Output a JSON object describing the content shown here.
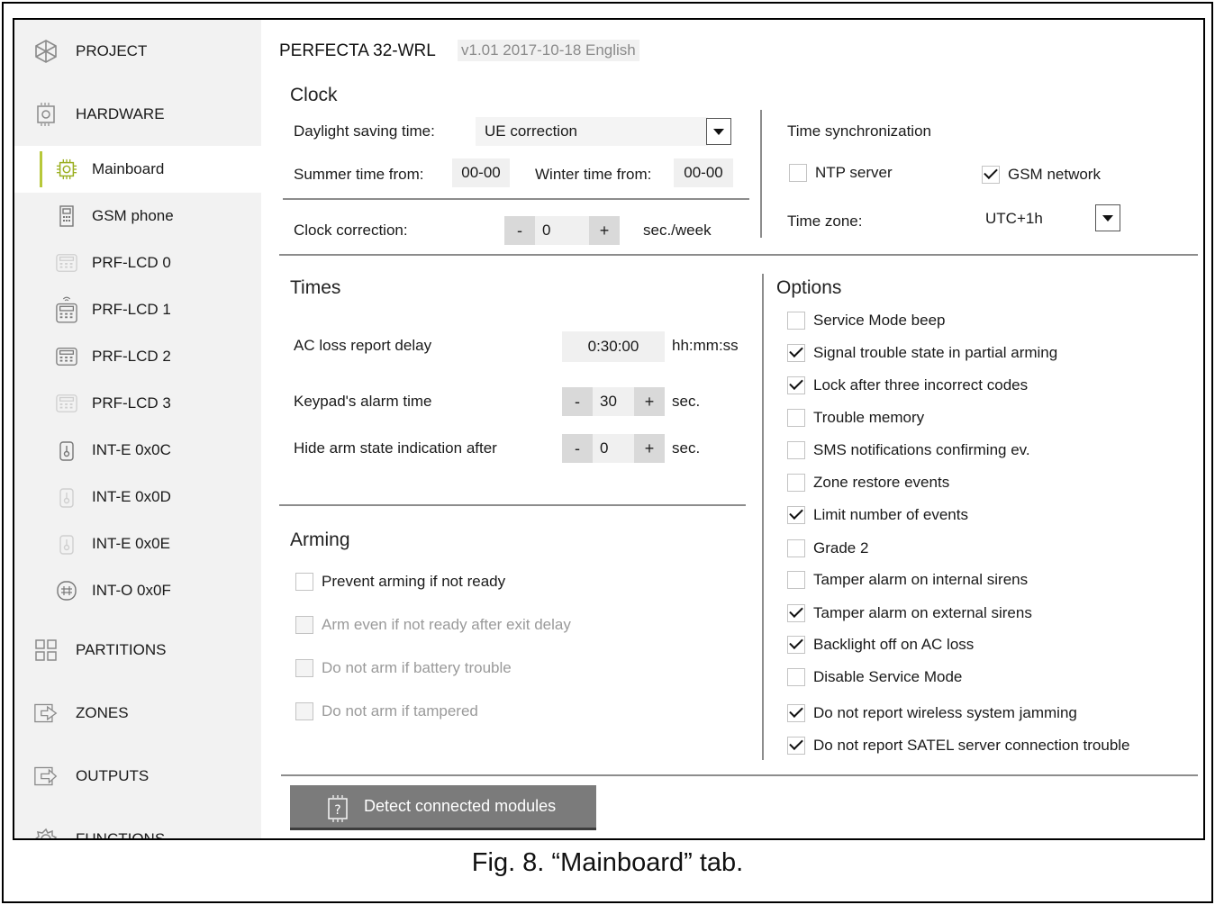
{
  "caption": "Fig. 8. “Mainboard” tab.",
  "sidebar": {
    "sections": [
      {
        "label": "PROJECT",
        "icon": "project-icon"
      },
      {
        "label": "HARDWARE",
        "icon": "hardware-icon"
      },
      {
        "label": "PARTITIONS",
        "icon": "partitions-icon"
      },
      {
        "label": "ZONES",
        "icon": "zones-icon"
      },
      {
        "label": "OUTPUTS",
        "icon": "outputs-icon"
      },
      {
        "label": "FUNCTIONS",
        "icon": "functions-icon"
      }
    ],
    "hardware_items": [
      {
        "label": "Mainboard",
        "icon": "mainboard-icon",
        "state": "active"
      },
      {
        "label": "GSM phone",
        "icon": "phone-icon",
        "state": "normal"
      },
      {
        "label": "PRF-LCD 0",
        "icon": "keypad-icon",
        "state": "disabled"
      },
      {
        "label": "PRF-LCD 1",
        "icon": "wireless-keypad-icon",
        "state": "normal"
      },
      {
        "label": "PRF-LCD 2",
        "icon": "keypad-icon",
        "state": "normal"
      },
      {
        "label": "PRF-LCD 3",
        "icon": "keypad-icon",
        "state": "disabled"
      },
      {
        "label": "INT-E 0x0C",
        "icon": "expander-icon",
        "state": "normal"
      },
      {
        "label": "INT-E 0x0D",
        "icon": "expander-icon",
        "state": "disabled"
      },
      {
        "label": "INT-E 0x0E",
        "icon": "expander-icon",
        "state": "disabled"
      },
      {
        "label": "INT-O 0x0F",
        "icon": "output-expander-icon",
        "state": "normal"
      }
    ]
  },
  "header": {
    "device": "PERFECTA 32-WRL",
    "version": "v1.01 2017-10-18 English"
  },
  "clock": {
    "title": "Clock",
    "dst_label": "Daylight saving time:",
    "dst_value": "UE correction",
    "summer_label": "Summer time from:",
    "summer_value": "00-00",
    "winter_label": "Winter time from:",
    "winter_value": "00-00",
    "correction_label": "Clock correction:",
    "correction_minus": "-",
    "correction_value": "0",
    "correction_plus": "+",
    "correction_unit": "sec./week",
    "sync_label": "Time synchronization",
    "ntp_label": "NTP server",
    "ntp_checked": false,
    "gsm_label": "GSM network",
    "gsm_checked": true,
    "tz_label": "Time zone:",
    "tz_value": "UTC+1h"
  },
  "times": {
    "title": "Times",
    "ac_label": "AC loss report delay",
    "ac_value": "0:30:00",
    "ac_unit": "hh:mm:ss",
    "alarm_label": "Keypad's alarm time",
    "alarm_value": "30",
    "alarm_unit": "sec.",
    "hide_label": "Hide arm state indication after",
    "hide_value": "0",
    "hide_unit": "sec.",
    "minus": "-",
    "plus": "+"
  },
  "arming": {
    "title": "Arming",
    "items": [
      {
        "label": "Prevent arming if not ready",
        "checked": false,
        "disabled": false
      },
      {
        "label": "Arm even if not ready after exit delay",
        "checked": false,
        "disabled": true
      },
      {
        "label": "Do not arm if battery trouble",
        "checked": false,
        "disabled": true
      },
      {
        "label": "Do not arm if tampered",
        "checked": false,
        "disabled": true
      }
    ]
  },
  "options": {
    "title": "Options",
    "items": [
      {
        "label": "Service Mode beep",
        "checked": false
      },
      {
        "label": "Signal trouble state in partial arming",
        "checked": true
      },
      {
        "label": "Lock after three incorrect codes",
        "checked": true
      },
      {
        "label": "Trouble memory",
        "checked": false
      },
      {
        "label": "SMS notifications confirming ev.",
        "checked": false
      },
      {
        "label": "Zone restore events",
        "checked": false
      },
      {
        "label": "Limit number of events",
        "checked": true
      },
      {
        "label": "Grade 2",
        "checked": false
      },
      {
        "label": "Tamper alarm on internal sirens",
        "checked": false
      },
      {
        "label": "Tamper alarm on external sirens",
        "checked": true
      },
      {
        "label": "Backlight off on AC loss",
        "checked": true
      },
      {
        "label": "Disable Service Mode",
        "checked": false
      },
      {
        "label": "Do not report wireless system jamming",
        "checked": true
      },
      {
        "label": "Do not report SATEL server connection trouble",
        "checked": true
      }
    ]
  },
  "detect_button": {
    "label": "Detect connected modules",
    "icon": "help-chip-icon"
  },
  "colors": {
    "accent": "#9aae1e",
    "sidebar_bg": "#f2f2f2",
    "button_bg": "#7b7b7b"
  }
}
